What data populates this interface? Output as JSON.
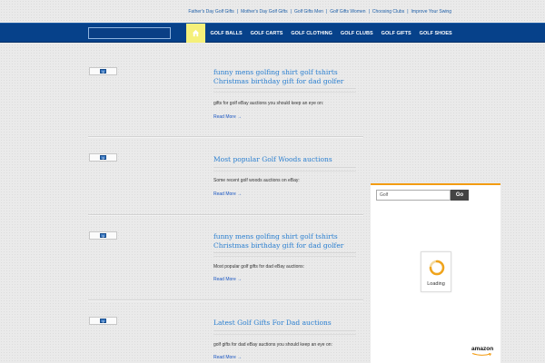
{
  "top_links": [
    "Father's Day Golf Gifts",
    "Mother's Day Golf Gifts",
    "Golf Gifts Men",
    "Golf Gifts Women",
    "Choosing Clubs",
    "Improve Your Swing"
  ],
  "nav": {
    "home_icon": "home-icon",
    "items": [
      "GOLF BALLS",
      "GOLF CARTS",
      "GOLF CLOTHING",
      "GOLF CLUBS",
      "GOLF GIFTS",
      "GOLF SHOES"
    ],
    "colors": {
      "bar": "#06418a",
      "home": "#f5f07a"
    }
  },
  "posts": [
    {
      "title_lines": [
        "funny mens golfing shirt golf tshirts",
        "Christmas birthday gift for dad golfer"
      ],
      "excerpt": "gifts for golf eBay auctions you should keep an eye on:",
      "read_more": "Read More →"
    },
    {
      "title_lines": [
        "Most popular Golf Woods auctions"
      ],
      "excerpt": "Some recent golf woods auctions on eBay:",
      "read_more": "Read More →"
    },
    {
      "title_lines": [
        "funny mens golfing shirt golf tshirts",
        "Christmas birthday gift for dad golfer"
      ],
      "excerpt": "Most popular golf gifts for dad eBay auctions:",
      "read_more": "Read More →"
    },
    {
      "title_lines": [
        "Latest Golf Gifts For Dad auctions"
      ],
      "excerpt": "golf gifts for dad eBay auctions you should keep an eye on:",
      "read_more": "Read More →"
    }
  ],
  "widget": {
    "search_value": "Golf",
    "go_label": "Go",
    "loading_label": "Loading",
    "logo_text": "amazon",
    "accent": "#f39c12"
  }
}
